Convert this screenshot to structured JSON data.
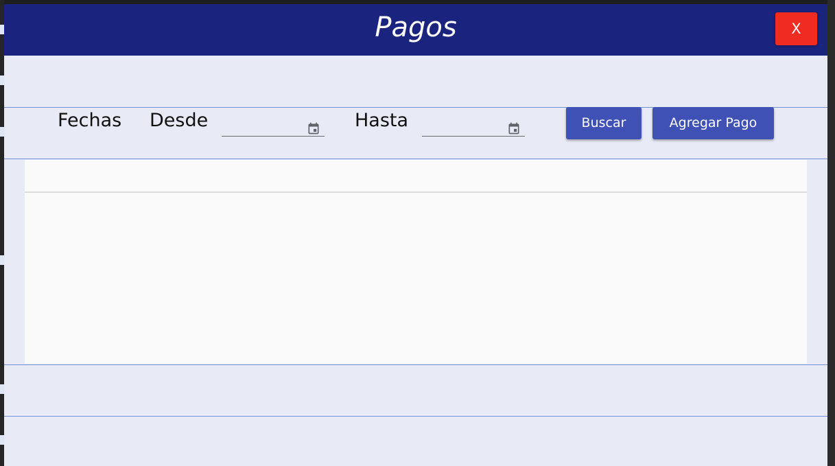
{
  "window": {
    "title": "Pagos",
    "close_label": "X"
  },
  "filters": {
    "fechas_label": "Fechas",
    "desde_label": "Desde",
    "desde_value": "",
    "hasta_label": "Hasta",
    "hasta_value": ""
  },
  "actions": {
    "buscar_label": "Buscar",
    "agregar_label": "Agregar Pago"
  },
  "payments_table": {
    "columns": [],
    "rows": []
  },
  "colors": {
    "titlebar": "#1a237e",
    "background": "#e8eaf6",
    "primary_button": "#3f51b5",
    "close_button": "#ef2b22",
    "table_background": "#fafafa"
  },
  "icons": {
    "date_picker": "calendar-icon"
  }
}
